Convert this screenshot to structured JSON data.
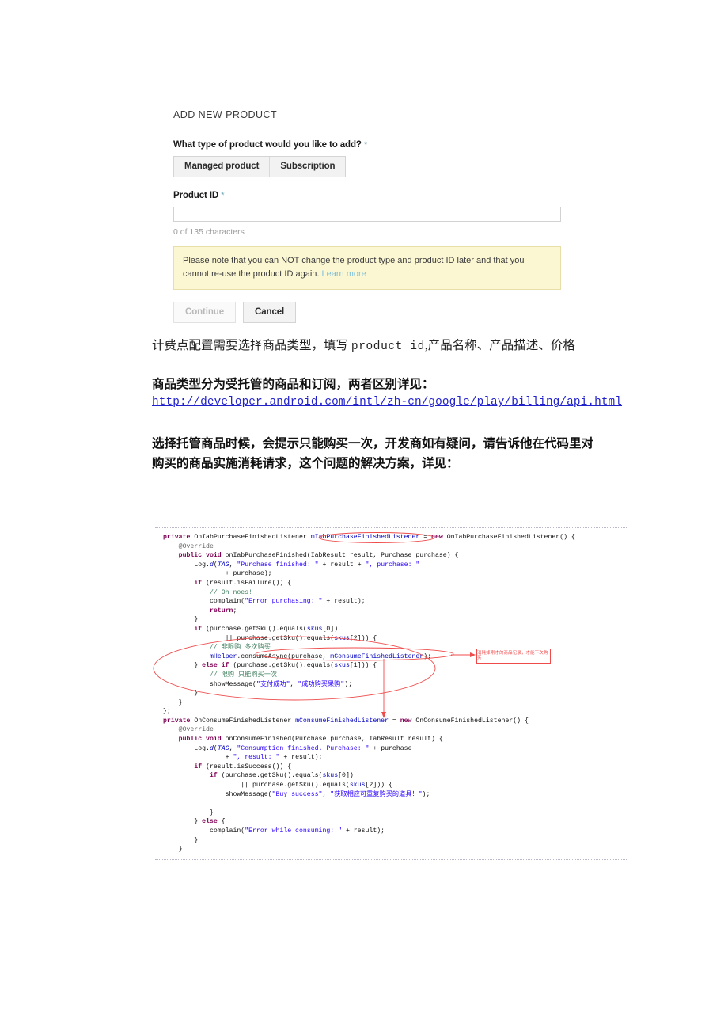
{
  "form": {
    "title": "ADD NEW PRODUCT",
    "product_type_label": "What type of product would you like to add?",
    "required_mark": "*",
    "segments": [
      {
        "label": "Managed product",
        "selected": true
      },
      {
        "label": "Subscription",
        "selected": false
      }
    ],
    "product_id_label": "Product ID",
    "product_id_value": "",
    "product_id_placeholder": "",
    "char_count": "0 of 135 characters",
    "notice_text": "Please note that you can NOT change the product type and product ID later and that you cannot re-use the product ID again.",
    "notice_link": "Learn more",
    "continue_label": "Continue",
    "cancel_label": "Cancel",
    "accent_required": "#6fa8b8",
    "notice_bg": "#fbf7d3",
    "notice_border": "#e8dfa8",
    "link_color": "#7fc0d8"
  },
  "prose": {
    "para1": "计费点配置需要选择商品类型，填写 ",
    "para1_mono": "product  id",
    "para1_tail": ",产品名称、产品描述、价格",
    "para2": "商品类型分为受托管的商品和订阅，两者区别详见：",
    "url": "http://developer.android.com/intl/zh-cn/google/play/billing/api.html",
    "para3_line1": "选择托管商品时候，会提示只能购买一次，开发商如有疑问，请告诉他在代码里对",
    "para3_line2": "购买的商品实施消耗请求，这个问题的解决方案，详见："
  },
  "code": {
    "lines": [
      [
        {
          "t": "private ",
          "c": "k"
        },
        {
          "t": "OnIabPurchaseFinishedListener ",
          "c": ""
        },
        {
          "t": "mIabPurchaseFinishedListener",
          "c": "f"
        },
        {
          "t": " = ",
          "c": ""
        },
        {
          "t": "new ",
          "c": "k"
        },
        {
          "t": "OnIabPurchaseFinishedListener() {",
          "c": ""
        }
      ],
      [
        {
          "t": "    @Override",
          "c": "an"
        }
      ],
      [
        {
          "t": "    ",
          "c": ""
        },
        {
          "t": "public void ",
          "c": "k"
        },
        {
          "t": "onIabPurchaseFinished(IabResult result, Purchase purchase) {",
          "c": ""
        }
      ],
      [
        {
          "t": "        Log.",
          "c": ""
        },
        {
          "t": "d",
          "c": "it"
        },
        {
          "t": "(",
          "c": ""
        },
        {
          "t": "TAG",
          "c": "it"
        },
        {
          "t": ", ",
          "c": ""
        },
        {
          "t": "\"Purchase finished: \"",
          "c": "s"
        },
        {
          "t": " + result + ",
          "c": ""
        },
        {
          "t": "\", purchase: \"",
          "c": "s"
        }
      ],
      [
        {
          "t": "                + purchase);",
          "c": ""
        }
      ],
      [
        {
          "t": "        ",
          "c": ""
        },
        {
          "t": "if ",
          "c": "k"
        },
        {
          "t": "(result.isFailure()) {",
          "c": ""
        }
      ],
      [
        {
          "t": "            ",
          "c": ""
        },
        {
          "t": "// Oh noes!",
          "c": "c"
        }
      ],
      [
        {
          "t": "            complain(",
          "c": ""
        },
        {
          "t": "\"Error purchasing: \"",
          "c": "s"
        },
        {
          "t": " + result);",
          "c": ""
        }
      ],
      [
        {
          "t": "            ",
          "c": ""
        },
        {
          "t": "return",
          "c": "k"
        },
        {
          "t": ";",
          "c": ""
        }
      ],
      [
        {
          "t": "        }",
          "c": ""
        }
      ],
      [
        {
          "t": "        ",
          "c": ""
        },
        {
          "t": "if ",
          "c": "k"
        },
        {
          "t": "(purchase.getSku().equals(",
          "c": ""
        },
        {
          "t": "skus",
          "c": "f"
        },
        {
          "t": "[0])",
          "c": ""
        }
      ],
      [
        {
          "t": "                || purchase.getSku().equals(",
          "c": ""
        },
        {
          "t": "skus",
          "c": "f"
        },
        {
          "t": "[2])) {",
          "c": ""
        }
      ],
      [
        {
          "t": "            ",
          "c": ""
        },
        {
          "t": "// 非限购 多次购买",
          "c": "c"
        }
      ],
      [
        {
          "t": "            ",
          "c": ""
        },
        {
          "t": "mHelper",
          "c": "f"
        },
        {
          "t": ".consumeAsync(purchase, ",
          "c": ""
        },
        {
          "t": "mConsumeFinishedListener",
          "c": "f"
        },
        {
          "t": ");",
          "c": ""
        }
      ],
      [
        {
          "t": "        } ",
          "c": ""
        },
        {
          "t": "else if ",
          "c": "k"
        },
        {
          "t": "(purchase.getSku().equals(",
          "c": ""
        },
        {
          "t": "skus",
          "c": "f"
        },
        {
          "t": "[1])) {",
          "c": ""
        }
      ],
      [
        {
          "t": "            ",
          "c": ""
        },
        {
          "t": "// 限购 只能购买一次",
          "c": "c"
        }
      ],
      [
        {
          "t": "            showMessage(",
          "c": ""
        },
        {
          "t": "\"支付成功\"",
          "c": "s"
        },
        {
          "t": ", ",
          "c": ""
        },
        {
          "t": "\"成功购买果购\"",
          "c": "s"
        },
        {
          "t": ");",
          "c": ""
        }
      ],
      [
        {
          "t": "        }",
          "c": ""
        }
      ],
      [
        {
          "t": "    }",
          "c": ""
        }
      ],
      [
        {
          "t": "};",
          "c": ""
        }
      ],
      [
        {
          "t": "private ",
          "c": "k"
        },
        {
          "t": "OnConsumeFinishedListener ",
          "c": ""
        },
        {
          "t": "mConsumeFinishedListener",
          "c": "f"
        },
        {
          "t": " = ",
          "c": ""
        },
        {
          "t": "new ",
          "c": "k"
        },
        {
          "t": "OnConsumeFinishedListener() {",
          "c": ""
        }
      ],
      [
        {
          "t": "    @Override",
          "c": "an"
        }
      ],
      [
        {
          "t": "    ",
          "c": ""
        },
        {
          "t": "public void ",
          "c": "k"
        },
        {
          "t": "onConsumeFinished(Purchase purchase, IabResult result) {",
          "c": ""
        }
      ],
      [
        {
          "t": "        Log.",
          "c": ""
        },
        {
          "t": "d",
          "c": "it"
        },
        {
          "t": "(",
          "c": ""
        },
        {
          "t": "TAG",
          "c": "it"
        },
        {
          "t": ", ",
          "c": ""
        },
        {
          "t": "\"Consumption finished. Purchase: \"",
          "c": "s"
        },
        {
          "t": " + purchase",
          "c": ""
        }
      ],
      [
        {
          "t": "                + ",
          "c": ""
        },
        {
          "t": "\", result: \"",
          "c": "s"
        },
        {
          "t": " + result);",
          "c": ""
        }
      ],
      [
        {
          "t": "        ",
          "c": ""
        },
        {
          "t": "if ",
          "c": "k"
        },
        {
          "t": "(result.isSuccess()) {",
          "c": ""
        }
      ],
      [
        {
          "t": "            ",
          "c": ""
        },
        {
          "t": "if ",
          "c": "k"
        },
        {
          "t": "(purchase.getSku().equals(",
          "c": ""
        },
        {
          "t": "skus",
          "c": "f"
        },
        {
          "t": "[0])",
          "c": ""
        }
      ],
      [
        {
          "t": "                    || purchase.getSku().equals(",
          "c": ""
        },
        {
          "t": "skus",
          "c": "f"
        },
        {
          "t": "[2])) {",
          "c": ""
        }
      ],
      [
        {
          "t": "                showMessage(",
          "c": ""
        },
        {
          "t": "\"Buy success\"",
          "c": "s"
        },
        {
          "t": ", ",
          "c": ""
        },
        {
          "t": "\"获取相应可重复购买的道具！\"",
          "c": "s"
        },
        {
          "t": ");",
          "c": ""
        }
      ],
      [
        {
          "t": "",
          "c": ""
        }
      ],
      [
        {
          "t": "            }",
          "c": ""
        }
      ],
      [
        {
          "t": "        } ",
          "c": ""
        },
        {
          "t": "else ",
          "c": "k"
        },
        {
          "t": "{",
          "c": ""
        }
      ],
      [
        {
          "t": "            complain(",
          "c": ""
        },
        {
          "t": "\"Error while consuming: \"",
          "c": "s"
        },
        {
          "t": " + result);",
          "c": ""
        }
      ],
      [
        {
          "t": "        }",
          "c": ""
        }
      ],
      [
        {
          "t": "    }",
          "c": ""
        }
      ]
    ]
  },
  "annotation": {
    "callout_text": "消耗掉刚才的商品记录，才能下次购买",
    "color": "#ef4b4b"
  }
}
